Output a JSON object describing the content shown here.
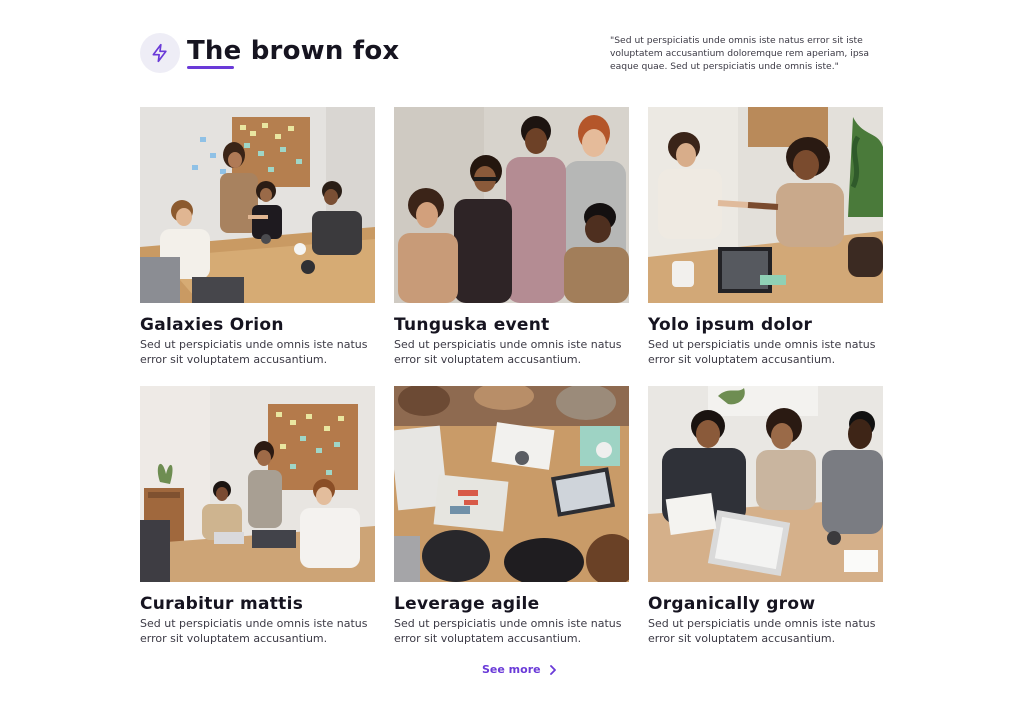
{
  "header": {
    "title": "The brown fox",
    "quote": "\"Sed ut perspiciatis unde omnis iste natus error sit iste voluptatem accusantium doloremque rem aperiam, ipsa eaque quae. Sed ut perspiciatis unde omnis iste.\"",
    "logo_icon": "lightning-bolt-icon"
  },
  "colors": {
    "accent": "#6a3ad8",
    "logo_bg": "#eeedf6",
    "text": "#161420"
  },
  "cards": [
    {
      "title": "Galaxies Orion",
      "text": "Sed ut perspiciatis unde omnis iste natus error sit voluptatem accusantium."
    },
    {
      "title": "Tunguska event",
      "text": "Sed ut perspiciatis unde omnis iste natus error sit voluptatem accusantium."
    },
    {
      "title": "Yolo ipsum dolor",
      "text": "Sed ut perspiciatis unde omnis iste natus error sit voluptatem accusantium."
    },
    {
      "title": "Curabitur mattis",
      "text": "Sed ut perspiciatis unde omnis iste natus error sit voluptatem accusantium."
    },
    {
      "title": "Leverage agile",
      "text": "Sed ut perspiciatis unde omnis iste natus error sit voluptatem accusantium."
    },
    {
      "title": "Organically grow",
      "text": "Sed ut perspiciatis unde omnis iste natus error sit voluptatem accusantium."
    }
  ],
  "footer": {
    "see_more_label": "See more",
    "see_more_icon": "chevron-right-icon"
  }
}
